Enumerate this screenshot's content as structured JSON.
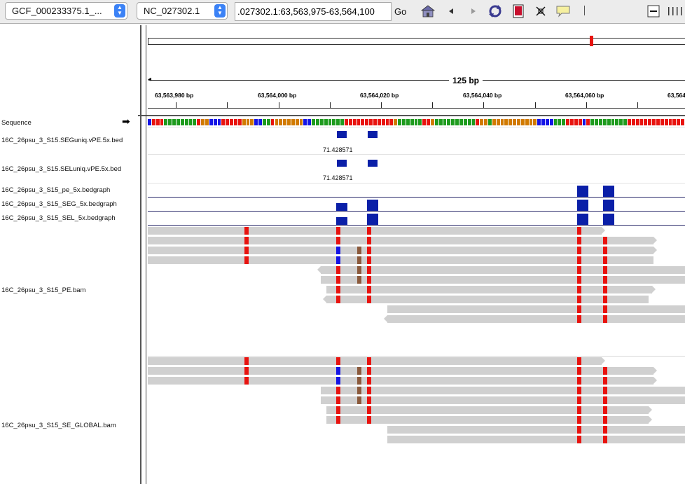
{
  "toolbar": {
    "genome_select": "GCF_000233375.1_...",
    "chromosome_select": "NC_027302.1",
    "locus_value": ".027302.1:63,563,975-63,564,100",
    "go_label": "Go",
    "icons": [
      "home-icon",
      "back-icon",
      "forward-icon",
      "refresh-icon",
      "roi-icon",
      "fit-icon",
      "popup-info-icon",
      "zoom-out-icon",
      "zoom-slider-icon"
    ]
  },
  "ruler": {
    "span_label": "125 bp",
    "position_labels": [
      "63,563,980 bp",
      "63,564,000 bp",
      "63,564,020 bp",
      "63,564,040 bp",
      "63,564,060 bp",
      "63,564"
    ]
  },
  "tracks": {
    "sequence": "Sequence",
    "seguniq_bed": "16C_26psu_3_S15.SEGuniq.vPE.5x.bed",
    "seluniq_bed": "16C_26psu_3_S15.SELuniq.vPE.5x.bed",
    "pe_bedgraph": "16C_26psu_3_S15_pe_5x.bedgraph",
    "seg_bedgraph": "16C_26psu_3_S15_SEG_5x.bedgraph",
    "sel_bedgraph": "16C_26psu_3_S15_SEL_5x.bedgraph",
    "pe_bam": "16C_26psu_3_S15_PE.bam",
    "se_global_bam": "16C_26psu_3_S15_SE_GLOBAL.bam"
  },
  "feature_values": {
    "seguniq_score": "71.428571",
    "seluniq_score": "71.428571"
  },
  "colors": {
    "feature_blue": "#0a1fa8",
    "mismatch_red": "#e8130f",
    "mismatch_blue": "#1414e6",
    "mismatch_brown": "#8b5a3c",
    "read_gray": "#d0d0d0",
    "base_A": "#1e9b1e",
    "base_C": "#1414e6",
    "base_G": "#d17a00",
    "base_T": "#e8130f"
  }
}
